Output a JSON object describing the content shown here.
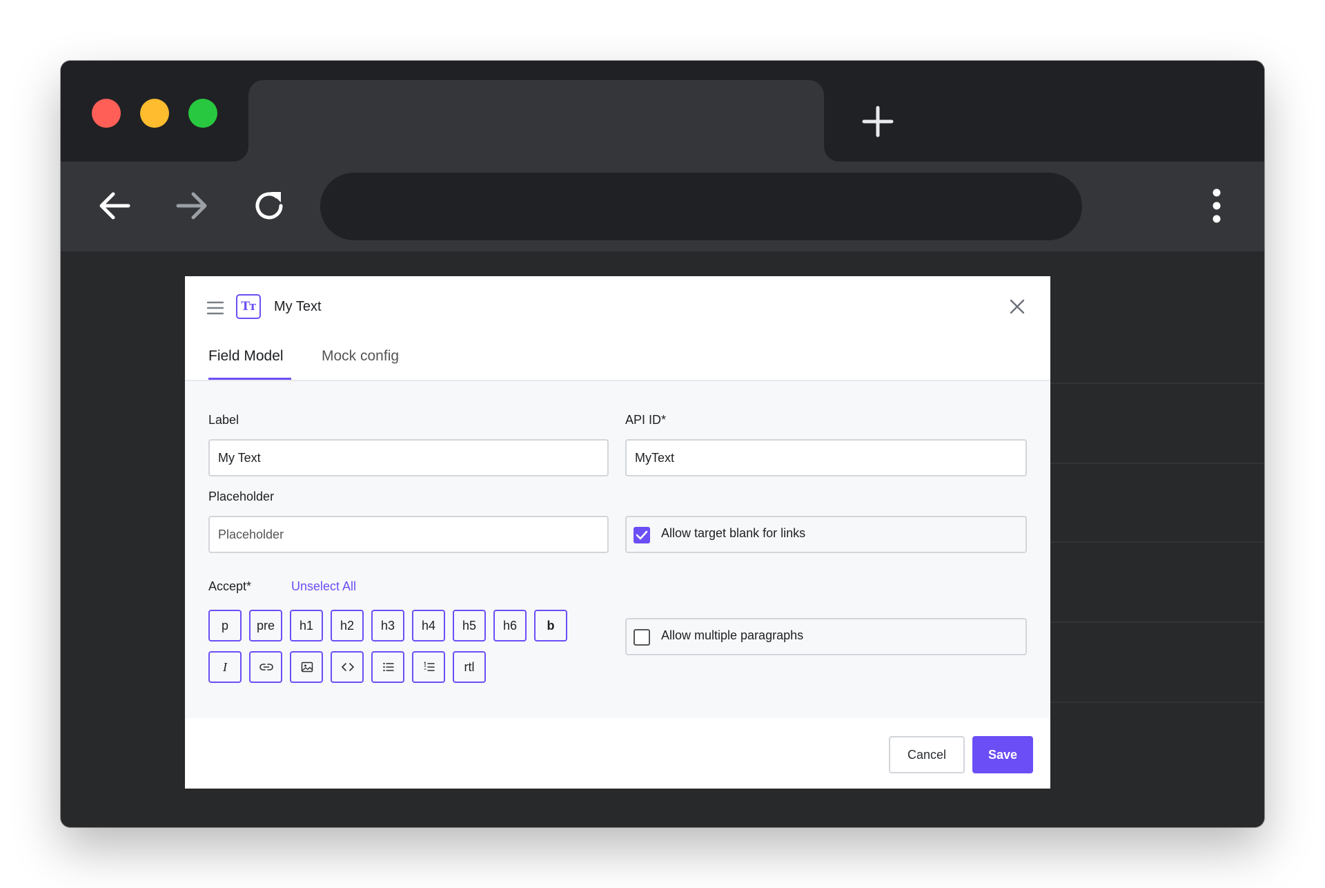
{
  "browser": {
    "new_tab_icon": "plus-icon",
    "back_icon": "arrow-left-icon",
    "forward_icon": "arrow-right-icon",
    "reload_icon": "reload-icon",
    "menu_icon": "more-vertical-icon"
  },
  "modal": {
    "title": "My Text",
    "field_icon_text": "Tт",
    "tabs": [
      {
        "label": "Field Model",
        "active": true
      },
      {
        "label": "Mock config",
        "active": false
      }
    ],
    "form": {
      "label_label": "Label",
      "label_value": "My Text",
      "api_id_label": "API ID*",
      "api_id_value": "MyText",
      "placeholder_label": "Placeholder",
      "placeholder_value": "Placeholder",
      "allow_target_blank_label": "Allow target blank for links",
      "allow_target_blank_checked": true,
      "allow_multiple_paragraphs_label": "Allow multiple paragraphs",
      "allow_multiple_paragraphs_checked": false,
      "accept_label": "Accept*",
      "unselect_all_label": "Unselect All",
      "accept_row1": [
        "p",
        "pre",
        "h1",
        "h2",
        "h3",
        "h4",
        "h5",
        "h6",
        "b"
      ],
      "accept_row2_icons": [
        "italic-icon",
        "link-icon",
        "image-icon",
        "code-icon",
        "bulleted-list-icon",
        "numbered-list-icon"
      ],
      "accept_rtl_label": "rtl",
      "accept_italic_label": "I"
    },
    "footer": {
      "cancel_label": "Cancel",
      "save_label": "Save"
    }
  },
  "colors": {
    "accent": "#6b4ef5",
    "browser_dark": "#202124",
    "toolbar": "#35363a"
  }
}
